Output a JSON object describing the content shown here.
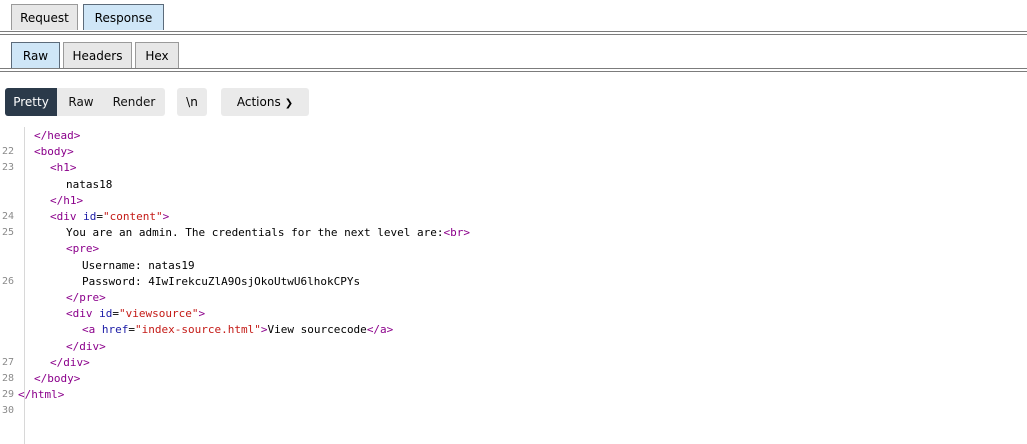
{
  "top_tabs": [
    {
      "label": "Request",
      "active": false
    },
    {
      "label": "Response",
      "active": true
    }
  ],
  "sub_tabs": [
    {
      "label": "Raw",
      "active": true
    },
    {
      "label": "Headers",
      "active": false
    },
    {
      "label": "Hex",
      "active": false
    }
  ],
  "toolbar": {
    "pretty": "Pretty",
    "raw": "Raw",
    "render": "Render",
    "newline": "\\n",
    "actions": "Actions",
    "active_color": "#2b3a4a"
  },
  "editor": {
    "line_numbers": [
      "",
      "22",
      "23",
      "",
      "",
      "24",
      "25",
      "",
      "",
      "26",
      "",
      "",
      "",
      "",
      "27",
      "28",
      "29",
      "30"
    ],
    "lines": [
      {
        "indent": 2,
        "parts": [
          {
            "t": "tag",
            "v": "</head>"
          }
        ]
      },
      {
        "indent": 2,
        "parts": [
          {
            "t": "tag",
            "v": "<body>"
          }
        ]
      },
      {
        "indent": 3,
        "parts": [
          {
            "t": "tag",
            "v": "<h1>"
          }
        ]
      },
      {
        "indent": 4,
        "parts": [
          {
            "t": "txt",
            "v": "natas18"
          }
        ]
      },
      {
        "indent": 3,
        "parts": [
          {
            "t": "tag",
            "v": "</h1>"
          }
        ]
      },
      {
        "indent": 3,
        "parts": [
          {
            "t": "tag",
            "v": "<div "
          },
          {
            "t": "attr",
            "v": "id"
          },
          {
            "t": "txt",
            "v": "="
          },
          {
            "t": "val",
            "v": "\"content\""
          },
          {
            "t": "tag",
            "v": ">"
          }
        ]
      },
      {
        "indent": 4,
        "parts": [
          {
            "t": "txt",
            "v": "You are an admin. The credentials for the next level are:"
          },
          {
            "t": "tag",
            "v": "<br>"
          }
        ]
      },
      {
        "indent": 4,
        "parts": [
          {
            "t": "tag",
            "v": "<pre>"
          }
        ]
      },
      {
        "indent": 5,
        "parts": [
          {
            "t": "txt",
            "v": "Username: natas19"
          }
        ]
      },
      {
        "indent": 5,
        "parts": [
          {
            "t": "txt",
            "v": "Password: 4IwIrekcuZlA9OsjOkoUtwU6lhokCPYs"
          }
        ]
      },
      {
        "indent": 4,
        "parts": [
          {
            "t": "tag",
            "v": "</pre>"
          }
        ]
      },
      {
        "indent": 4,
        "parts": [
          {
            "t": "tag",
            "v": "<div "
          },
          {
            "t": "attr",
            "v": "id"
          },
          {
            "t": "txt",
            "v": "="
          },
          {
            "t": "val",
            "v": "\"viewsource\""
          },
          {
            "t": "tag",
            "v": ">"
          }
        ]
      },
      {
        "indent": 5,
        "parts": [
          {
            "t": "tag",
            "v": "<a "
          },
          {
            "t": "attr",
            "v": "href"
          },
          {
            "t": "txt",
            "v": "="
          },
          {
            "t": "val",
            "v": "\"index-source.html\""
          },
          {
            "t": "tag",
            "v": ">"
          },
          {
            "t": "txt",
            "v": "View sourcecode"
          },
          {
            "t": "tag",
            "v": "</a>"
          }
        ]
      },
      {
        "indent": 4,
        "parts": [
          {
            "t": "tag",
            "v": "</div>"
          }
        ]
      },
      {
        "indent": 3,
        "parts": [
          {
            "t": "tag",
            "v": "</div>"
          }
        ]
      },
      {
        "indent": 2,
        "parts": [
          {
            "t": "tag",
            "v": "</body>"
          }
        ]
      },
      {
        "indent": 1,
        "parts": [
          {
            "t": "tag",
            "v": "</html>"
          }
        ]
      },
      {
        "indent": 1,
        "parts": []
      }
    ]
  }
}
